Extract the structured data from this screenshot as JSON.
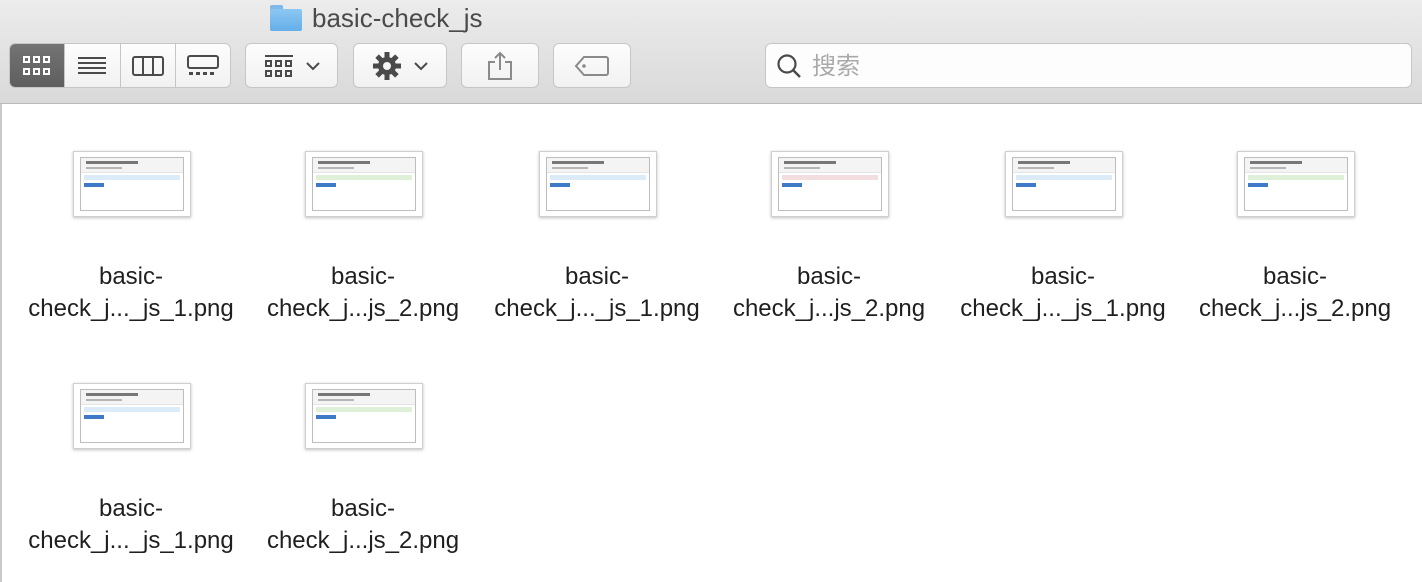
{
  "window": {
    "title": "basic-check_js",
    "folder_icon": "folder-icon"
  },
  "toolbar": {
    "view_buttons": [
      "icon-view",
      "list-view",
      "column-view",
      "gallery-view"
    ],
    "group_button": "group-icon",
    "action_button": "gear-icon",
    "share_button": "share-icon",
    "tag_button": "tag-icon"
  },
  "search": {
    "placeholder": "搜索",
    "value": ""
  },
  "files": [
    {
      "line1": "basic-",
      "line2": "check_j..._js_1.png",
      "tint": "#dcebf8"
    },
    {
      "line1": "basic-",
      "line2": "check_j...js_2.png",
      "tint": "#dff0d8"
    },
    {
      "line1": "basic-",
      "line2": "check_j..._js_1.png",
      "tint": "#dcebf8"
    },
    {
      "line1": "basic-",
      "line2": "check_j...js_2.png",
      "tint": "#f2dede"
    },
    {
      "line1": "basic-",
      "line2": "check_j..._js_1.png",
      "tint": "#dcebf8"
    },
    {
      "line1": "basic-",
      "line2": "check_j...js_2.png",
      "tint": "#dff0d8"
    },
    {
      "line1": "basic-",
      "line2": "check_j..._js_1.png",
      "tint": "#dcebf8"
    },
    {
      "line1": "basic-",
      "line2": "check_j...js_2.png",
      "tint": "#dff0d8"
    }
  ]
}
